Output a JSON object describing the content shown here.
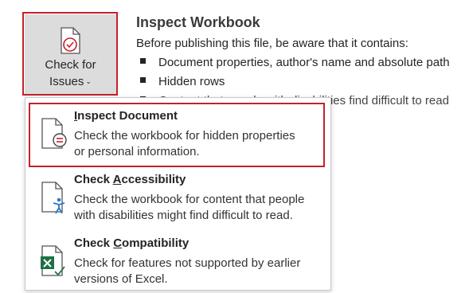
{
  "check_button": {
    "label_line1": "Check for",
    "label_line2": "Issues",
    "caret": "⌄",
    "icon": "check-document-icon"
  },
  "inspect_workbook": {
    "title": "Inspect Workbook",
    "description": "Before publishing this file, be aware that it contains:",
    "bullets": [
      "Document properties, author's name and absolute path",
      "Hidden rows",
      "Content that people with disabilities find difficult to read"
    ]
  },
  "menu": {
    "items": [
      {
        "title_pre": "",
        "title_underline": "I",
        "title_post": "nspect Document",
        "line1": "Check the workbook for hidden properties",
        "line2": "or personal information.",
        "icon": "inspect-document-icon"
      },
      {
        "title_pre": "Check ",
        "title_underline": "A",
        "title_post": "ccessibility",
        "line1": "Check the workbook for content that people",
        "line2": "with disabilities might find difficult to read.",
        "icon": "accessibility-icon"
      },
      {
        "title_pre": "Check ",
        "title_underline": "C",
        "title_post": "ompatibility",
        "line1": "Check for features not supported by earlier",
        "line2": "versions of Excel.",
        "icon": "excel-compatibility-icon"
      }
    ]
  },
  "colors": {
    "highlight": "#c4212a",
    "button_bg": "#dcdcdc",
    "accent_blue": "#2b78c5",
    "excel_green": "#1e7145"
  }
}
